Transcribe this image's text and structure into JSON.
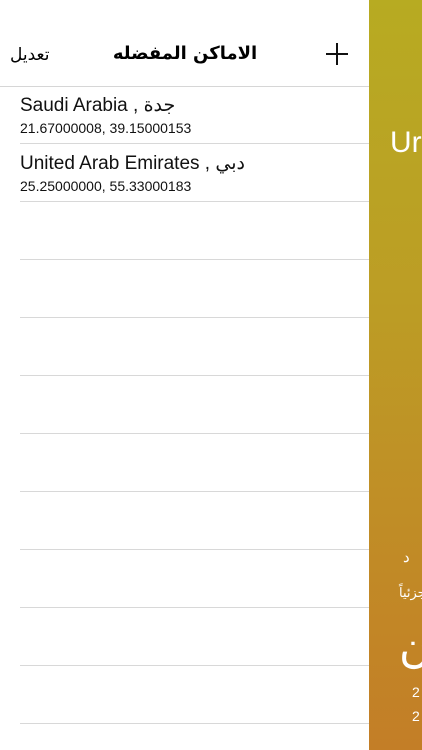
{
  "navbar": {
    "edit_label": "تعديل",
    "title": "الاماكن المفضله",
    "add_icon": "plus-icon"
  },
  "favorites": [
    {
      "country": "Saudi Arabia",
      "city": "جدة",
      "coordinates": "21.67000008, 39.15000153"
    },
    {
      "country": "United Arab Emirates",
      "city": "دبي",
      "coordinates": "25.25000000, 55.33000183"
    }
  ],
  "background_peek": {
    "title_fragment": "Ur",
    "line_a_fragment": "د",
    "line_b_fragment": "جزئياً",
    "large_fragment": "ن",
    "line_d_fragment": "2",
    "line_e_fragment": "2"
  },
  "colors": {
    "backdrop_top": "#b7ab22",
    "backdrop_bottom": "#c37e27",
    "separator": "#d8d8d8"
  }
}
